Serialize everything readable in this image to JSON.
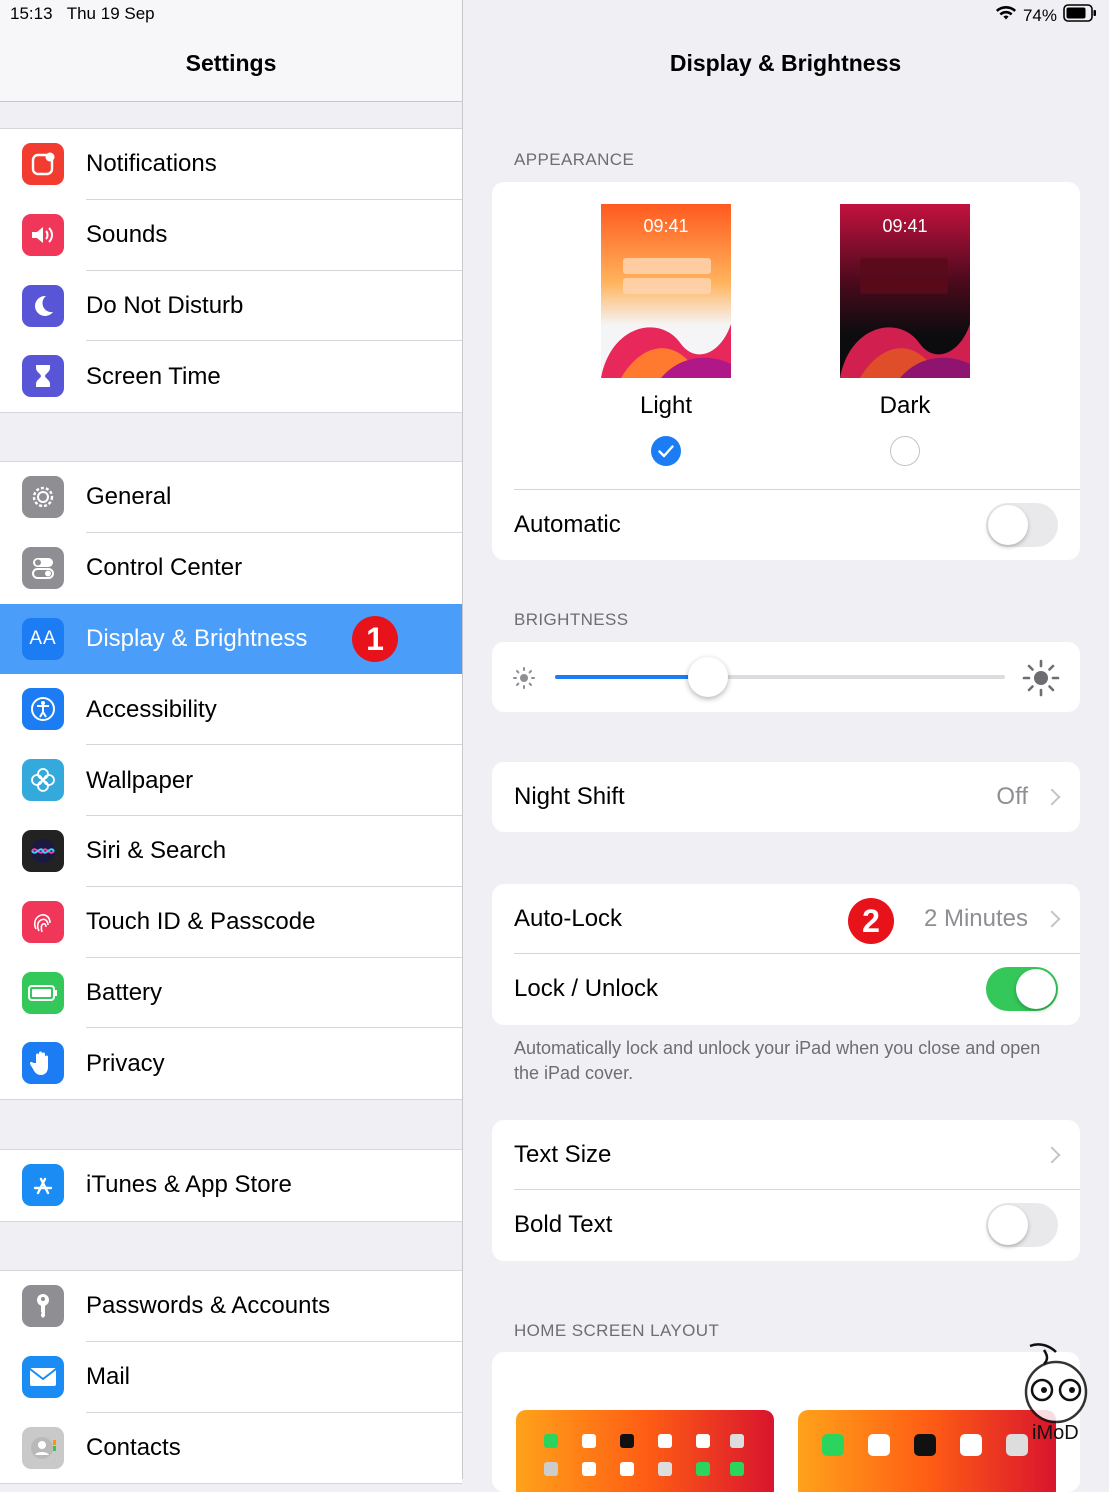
{
  "status": {
    "time": "15:13",
    "date": "Thu 19 Sep",
    "battery": "74%"
  },
  "sidebar": {
    "title": "Settings",
    "groups": [
      [
        {
          "label": "Notifications",
          "icon": "notifications-icon",
          "color": "#f23c30"
        },
        {
          "label": "Sounds",
          "icon": "speaker-icon",
          "color": "#f0375a"
        },
        {
          "label": "Do Not Disturb",
          "icon": "moon-icon",
          "color": "#5856d6"
        },
        {
          "label": "Screen Time",
          "icon": "hourglass-icon",
          "color": "#5856d6"
        }
      ],
      [
        {
          "label": "General",
          "icon": "gear-icon",
          "color": "#8e8e93"
        },
        {
          "label": "Control Center",
          "icon": "switches-icon",
          "color": "#8e8e93"
        },
        {
          "label": "Display & Brightness",
          "icon": "aa-icon",
          "color": "#1b7cf3",
          "selected": true
        },
        {
          "label": "Accessibility",
          "icon": "accessibility-icon",
          "color": "#1b7cf3"
        },
        {
          "label": "Wallpaper",
          "icon": "flower-icon",
          "color": "#34aadc"
        },
        {
          "label": "Siri & Search",
          "icon": "siri-icon",
          "color": "#222222"
        },
        {
          "label": "Touch ID & Passcode",
          "icon": "fingerprint-icon",
          "color": "#f0375a"
        },
        {
          "label": "Battery",
          "icon": "battery-icon",
          "color": "#34c759"
        },
        {
          "label": "Privacy",
          "icon": "hand-icon",
          "color": "#1b7cf3"
        }
      ],
      [
        {
          "label": "iTunes & App Store",
          "icon": "app-store-icon",
          "color": "#1b8cf3"
        }
      ],
      [
        {
          "label": "Passwords & Accounts",
          "icon": "key-icon",
          "color": "#8e8e93"
        },
        {
          "label": "Mail",
          "icon": "mail-icon",
          "color": "#1b8cf3"
        },
        {
          "label": "Contacts",
          "icon": "contacts-icon",
          "color": "#c9c9c9"
        }
      ]
    ]
  },
  "annotations": {
    "step1": "1",
    "step2": "2"
  },
  "detail": {
    "title": "Display & Brightness",
    "appearance": {
      "section": "APPEARANCE",
      "light": {
        "label": "Light",
        "time": "09:41",
        "selected": true
      },
      "dark": {
        "label": "Dark",
        "time": "09:41",
        "selected": false
      },
      "automatic": {
        "label": "Automatic",
        "on": false
      }
    },
    "brightness": {
      "section": "BRIGHTNESS",
      "level": 0.34
    },
    "night_shift": {
      "label": "Night Shift",
      "value": "Off"
    },
    "auto_lock": {
      "label": "Auto-Lock",
      "value": "2 Minutes"
    },
    "lock_unlock": {
      "label": "Lock / Unlock",
      "on": true,
      "footer": "Automatically lock and unlock your iPad when you close and open the iPad cover."
    },
    "text_size": {
      "label": "Text Size"
    },
    "bold_text": {
      "label": "Bold Text",
      "on": false
    },
    "home_screen": {
      "section": "HOME SCREEN LAYOUT"
    }
  },
  "watermark": "iMoD",
  "colors": {
    "accent": "#1b7cf3",
    "selection": "#4a9df8",
    "toggle_on": "#34c759",
    "badge": "#e8121b"
  }
}
